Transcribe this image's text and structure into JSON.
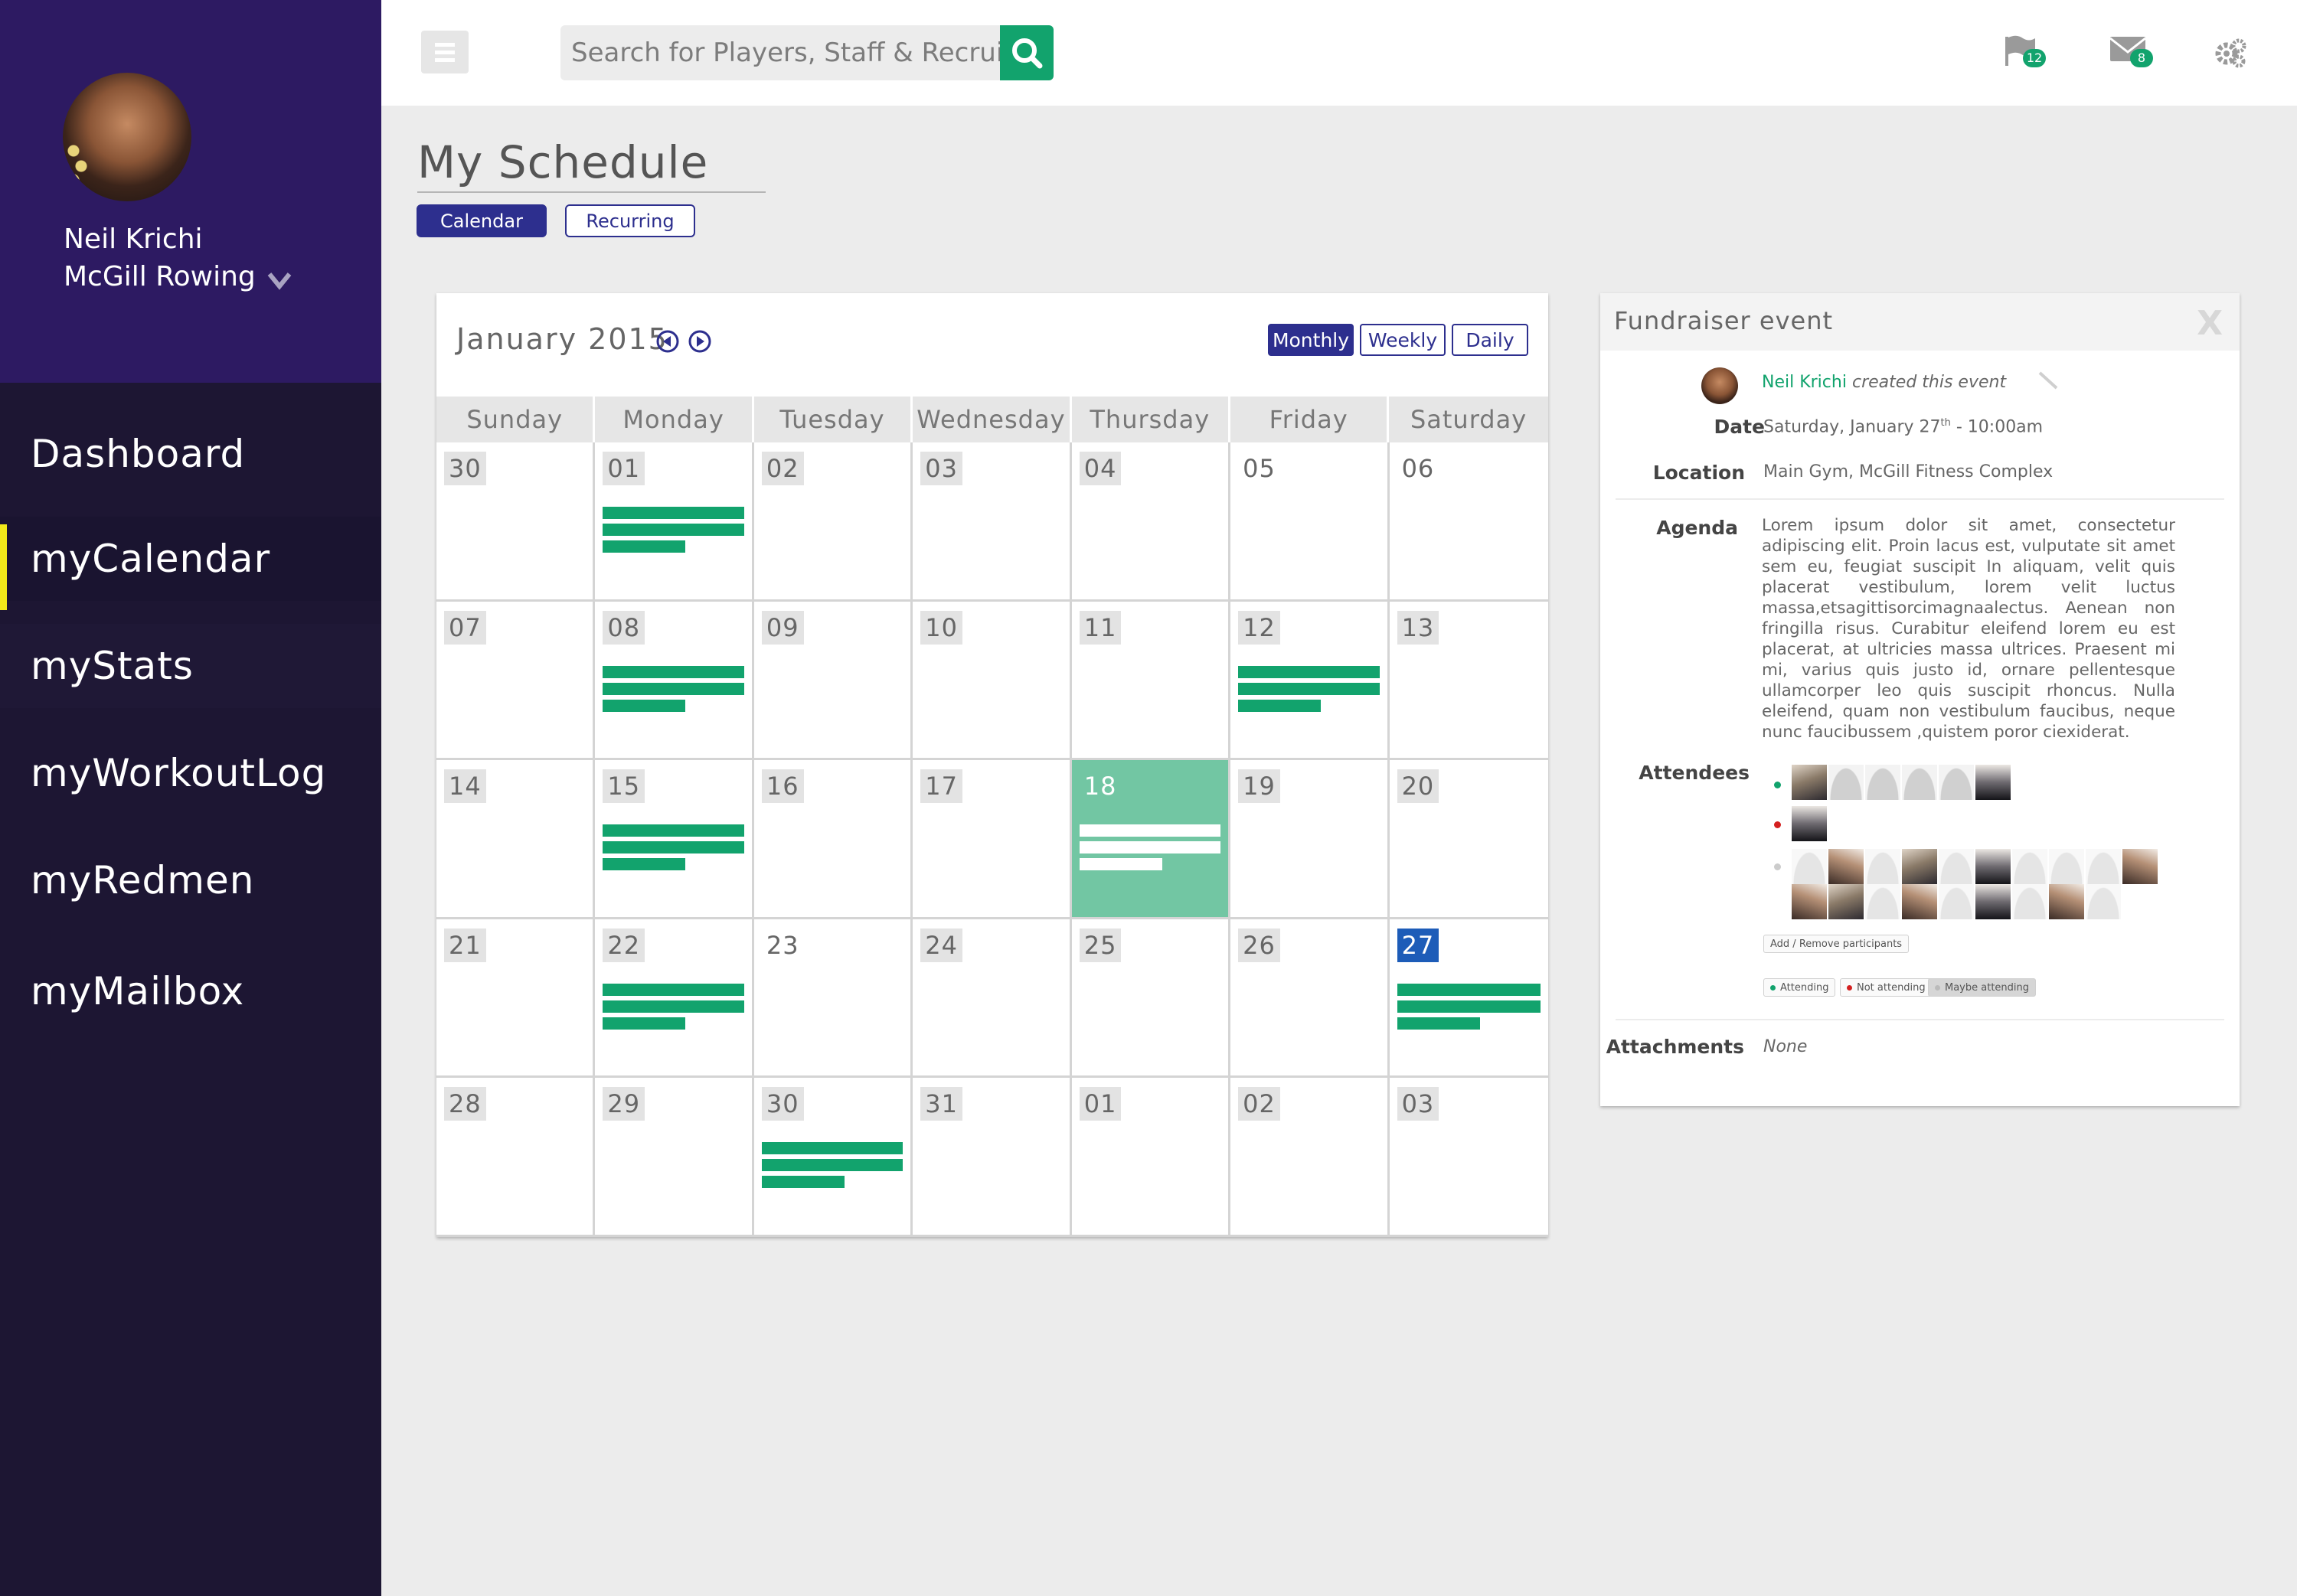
{
  "user": {
    "name": "Neil Krichi",
    "team": "McGill Rowing"
  },
  "nav": [
    {
      "label": "Dashboard"
    },
    {
      "label": "myCalendar"
    },
    {
      "label": "myStats"
    },
    {
      "label": "myWorkoutLog"
    },
    {
      "label": "myRedmen"
    },
    {
      "label": "myMailbox"
    }
  ],
  "search": {
    "placeholder": "Search for Players, Staff & Recruits"
  },
  "notifications": {
    "flags": "12",
    "mail": "8"
  },
  "page": {
    "title": "My Schedule",
    "toggle_calendar": "Calendar",
    "toggle_recurring": "Recurring"
  },
  "calendar": {
    "month_label": "January 2015",
    "modes": [
      "Monthly",
      "Weekly",
      "Daily"
    ],
    "active_mode": "Monthly",
    "weekdays": [
      "Sunday",
      "Monday",
      "Tuesday",
      "Wednesday",
      "Thursday",
      "Friday",
      "Saturday"
    ],
    "days": [
      {
        "label": "30",
        "events": 0
      },
      {
        "label": "01",
        "events": 3
      },
      {
        "label": "02",
        "events": 0
      },
      {
        "label": "03",
        "events": 0
      },
      {
        "label": "04",
        "events": 0
      },
      {
        "label": "05",
        "events": 0,
        "plain": true
      },
      {
        "label": "06",
        "events": 0,
        "plain": true
      },
      {
        "label": "07",
        "events": 0
      },
      {
        "label": "08",
        "events": 3
      },
      {
        "label": "09",
        "events": 0
      },
      {
        "label": "10",
        "events": 0
      },
      {
        "label": "11",
        "events": 0
      },
      {
        "label": "12",
        "events": 3
      },
      {
        "label": "13",
        "events": 0
      },
      {
        "label": "14",
        "events": 0
      },
      {
        "label": "15",
        "events": 3
      },
      {
        "label": "16",
        "events": 0
      },
      {
        "label": "17",
        "events": 0
      },
      {
        "label": "18",
        "events": 3,
        "today": true
      },
      {
        "label": "19",
        "events": 0
      },
      {
        "label": "20",
        "events": 0
      },
      {
        "label": "21",
        "events": 0
      },
      {
        "label": "22",
        "events": 3
      },
      {
        "label": "23",
        "events": 0,
        "plain": true
      },
      {
        "label": "24",
        "events": 0
      },
      {
        "label": "25",
        "events": 0
      },
      {
        "label": "26",
        "events": 0
      },
      {
        "label": "27",
        "events": 3,
        "selected": true
      },
      {
        "label": "28",
        "events": 0
      },
      {
        "label": "29",
        "events": 0
      },
      {
        "label": "30",
        "events": 3
      },
      {
        "label": "31",
        "events": 0
      },
      {
        "label": "01",
        "events": 0
      },
      {
        "label": "02",
        "events": 0
      },
      {
        "label": "03",
        "events": 0
      }
    ],
    "colors": {
      "event": "#12a36d",
      "today": "#72c6a3",
      "selected": "#1d5cb8"
    }
  },
  "event": {
    "title": "Fundraiser event",
    "close_label": "X",
    "creator": "Neil Krichi",
    "creator_suffix": "created this event",
    "date_label": "Date",
    "date_value": "Saturday, January 27",
    "date_sup": "th",
    "date_time": " - 10:00am",
    "location_label": "Location",
    "location_value": "Main Gym, McGill Fitness Complex",
    "agenda_label": "Agenda",
    "agenda_text": "Lorem ipsum dolor sit amet, consectetur adipiscing elit. Proin lacus est, vulputate sit amet sem eu, feugiat suscipit In aliquam, velit quis placerat vestibulum, lorem velit luctus massa,etsagittisorcimagnaalectus. Aenean non fringilla risus. Curabitur eleifend lorem eu est placerat, at ultricies massa ultrices. Praesent mi mi, varius quis justo id, ornare pellentesque ullamcorper leo quis suscipit rhoncus. Nulla eleifend, quam non vestibulum faucibus, neque nunc faucibussem ,quistem poror ciexiderat.",
    "attendees_label": "Attendees",
    "add_remove_label": "Add / Remove participants",
    "legend_attending": "Attending",
    "legend_not_attending": "Not attending",
    "legend_maybe": "Maybe attending",
    "attachments_label": "Attachments",
    "attachments_value": "None"
  }
}
